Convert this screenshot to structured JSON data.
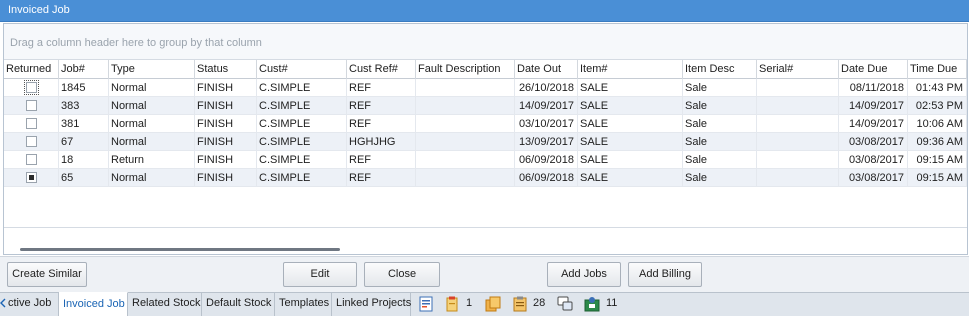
{
  "panel": {
    "title": "Invoiced Job"
  },
  "grid": {
    "group_hint": "Drag a column header here to group by that column",
    "columns": [
      "Returned",
      "Job#",
      "Type",
      "Status",
      "Cust#",
      "Cust Ref#",
      "Fault Description",
      "Date Out",
      "Item#",
      "Item Desc",
      "Serial#",
      "Date Due",
      "Time Due"
    ],
    "rows": [
      {
        "returned": false,
        "job": "1845",
        "type": "Normal",
        "status": "FINISH",
        "cust": "C.SIMPLE",
        "custref": "REF",
        "fault": "",
        "dateout": "26/10/2018",
        "item": "SALE",
        "itemdesc": "Sale",
        "serial": "",
        "datedue": "08/11/2018",
        "timedue": "01:43 PM"
      },
      {
        "returned": false,
        "job": "383",
        "type": "Normal",
        "status": "FINISH",
        "cust": "C.SIMPLE",
        "custref": "REF",
        "fault": "",
        "dateout": "14/09/2017",
        "item": "SALE",
        "itemdesc": "Sale",
        "serial": "",
        "datedue": "14/09/2017",
        "timedue": "02:53 PM"
      },
      {
        "returned": false,
        "job": "381",
        "type": "Normal",
        "status": "FINISH",
        "cust": "C.SIMPLE",
        "custref": "REF",
        "fault": "",
        "dateout": "03/10/2017",
        "item": "SALE",
        "itemdesc": "Sale",
        "serial": "",
        "datedue": "14/09/2017",
        "timedue": "10:06 AM"
      },
      {
        "returned": false,
        "job": "67",
        "type": "Normal",
        "status": "FINISH",
        "cust": "C.SIMPLE",
        "custref": "HGHJHG",
        "fault": "",
        "dateout": "13/09/2017",
        "item": "SALE",
        "itemdesc": "Sale",
        "serial": "",
        "datedue": "03/08/2017",
        "timedue": "09:36 AM"
      },
      {
        "returned": false,
        "job": "18",
        "type": "Return",
        "status": "FINISH",
        "cust": "C.SIMPLE",
        "custref": "REF",
        "fault": "",
        "dateout": "06/09/2018",
        "item": "SALE",
        "itemdesc": "Sale",
        "serial": "",
        "datedue": "03/08/2017",
        "timedue": "09:15 AM"
      },
      {
        "returned": true,
        "job": "65",
        "type": "Normal",
        "status": "FINISH",
        "cust": "C.SIMPLE",
        "custref": "REF",
        "fault": "",
        "dateout": "06/09/2018",
        "item": "SALE",
        "itemdesc": "Sale",
        "serial": "",
        "datedue": "03/08/2017",
        "timedue": "09:15 AM"
      }
    ]
  },
  "buttons": {
    "create_similar": "Create Similar",
    "edit": "Edit",
    "close": "Close",
    "add_jobs": "Add Jobs",
    "add_billing": "Add Billing"
  },
  "tabs": [
    "ctive Job",
    "Invoiced Job",
    "Related Stock",
    "Default Stock",
    "Templates",
    "Linked Projects"
  ],
  "status_icons": [
    {
      "icon": "form-icon",
      "count": ""
    },
    {
      "icon": "notes-icon",
      "count": "1"
    },
    {
      "icon": "documents-icon",
      "count": ""
    },
    {
      "icon": "clipboard-icon",
      "count": "28"
    },
    {
      "icon": "chat-icon",
      "count": ""
    },
    {
      "icon": "contacts-icon",
      "count": "11"
    }
  ],
  "colors": {
    "title_bar": "#4a8fd6",
    "active_tab_text": "#1a64b4",
    "row_alt": "#edf1f7"
  }
}
